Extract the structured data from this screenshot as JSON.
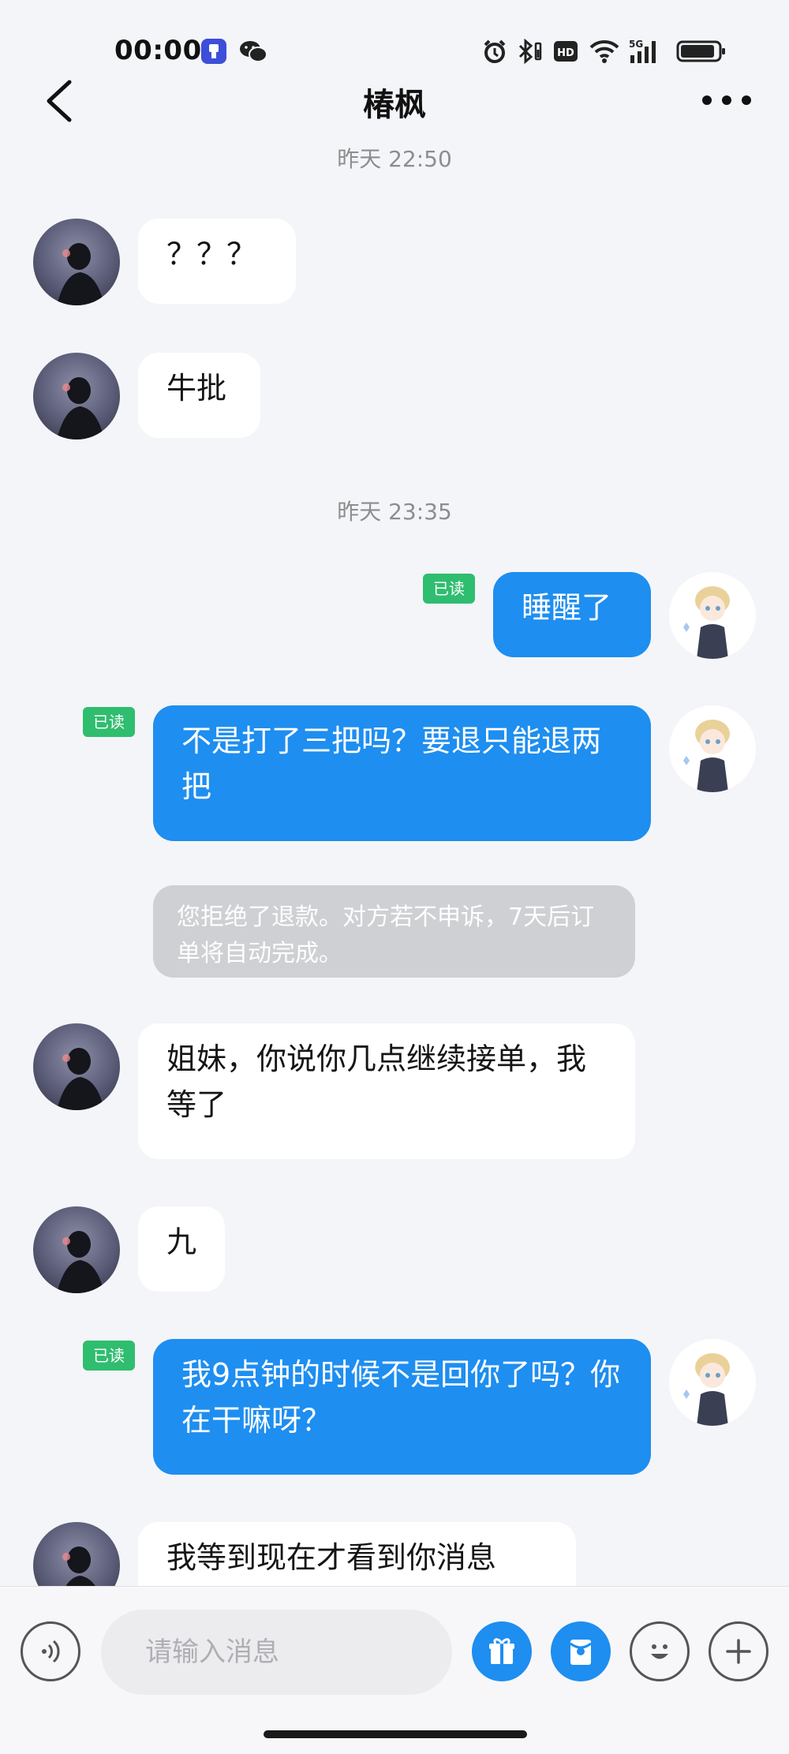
{
  "status_bar": {
    "time": "00:00"
  },
  "header": {
    "title": "椿枫"
  },
  "timestamps": [
    "昨天 22:50",
    "昨天 23:35"
  ],
  "messages": [
    {
      "side": "in",
      "text": "？？？"
    },
    {
      "side": "in",
      "text": "牛批"
    },
    {
      "side": "out",
      "text": "睡醒了",
      "status": "已读"
    },
    {
      "side": "out",
      "text": "不是打了三把吗？要退只能退两把",
      "status": "已读"
    },
    {
      "side": "system",
      "text": "您拒绝了退款。对方若不申诉，7天后订单将自动完成。"
    },
    {
      "side": "in",
      "text": "姐妹，你说你几点继续接单，我等了"
    },
    {
      "side": "in",
      "text": "九"
    },
    {
      "side": "out",
      "text": "我9点钟的时候不是回你了吗？你在干嘛呀？",
      "status": "已读"
    },
    {
      "side": "in",
      "text": "我等到现在才看到你消息"
    }
  ],
  "input": {
    "placeholder": "请输入消息"
  },
  "icons": {
    "status": [
      "app-notification-icon",
      "wechat-icon",
      "alarm-icon",
      "bluetooth-icon",
      "hd-icon",
      "wifi-icon",
      "5g-signal-icon",
      "battery-icon"
    ],
    "nav": [
      "back-icon",
      "more-icon"
    ],
    "toolbar": [
      "voice-icon",
      "gift-icon",
      "red-packet-icon",
      "emoji-icon",
      "add-icon"
    ]
  },
  "colors": {
    "background": "#f4f5f9",
    "outgoing_bubble": "#1e8ef0",
    "incoming_bubble": "#ffffff",
    "system_bubble": "#cfd0d3",
    "read_badge": "#2fbd6f",
    "toolbar_blue": "#1e8ef0"
  }
}
